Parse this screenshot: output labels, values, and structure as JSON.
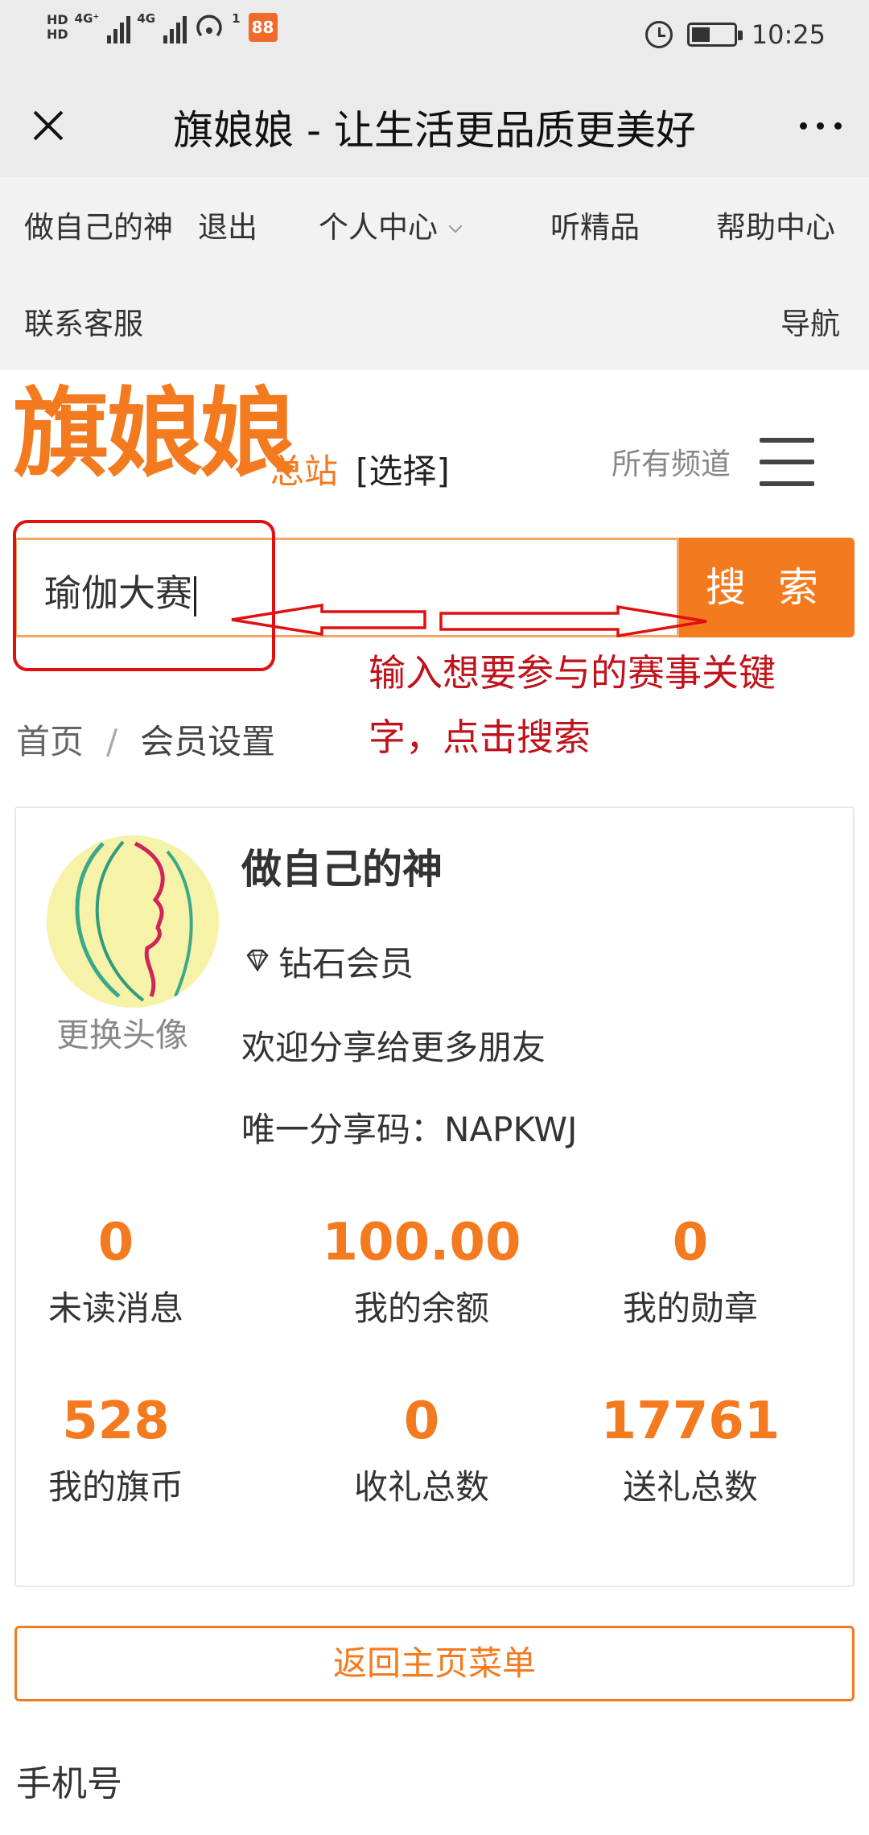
{
  "status_bar": {
    "hd1": "HD",
    "hd2": "HD",
    "net1": "4G⁺",
    "net2": "4G",
    "hotspot_sup": "1",
    "app_badge": "88",
    "time": "10:25"
  },
  "title_bar": {
    "title": "旗娘娘 - 让生活更品质更美好"
  },
  "top_nav": {
    "user": "做自己的神",
    "logout": "退出",
    "personal_center": "个人中心",
    "listen": "听精品",
    "help": "帮助中心",
    "contact": "联系客服",
    "navigate": "导航"
  },
  "header": {
    "logo": "旗娘娘",
    "station": "总站",
    "select": "[选择]",
    "channels": "所有频道"
  },
  "search": {
    "value": "瑜伽大赛",
    "button": "搜 索"
  },
  "annotation": {
    "line1": "输入想要参与的赛事关键",
    "line2": "字，点击搜索",
    "color": "#e01010"
  },
  "breadcrumb": {
    "home": "首页",
    "separator": "/",
    "current": "会员设置"
  },
  "profile": {
    "change_avatar": "更换头像",
    "username": "做自己的神",
    "member_level": "钻石会员",
    "welcome": "欢迎分享给更多朋友",
    "share_code": "唯一分享码：NAPKWJ",
    "stats": [
      {
        "value": "0",
        "label": "未读消息"
      },
      {
        "value": "100.00",
        "label": "我的余额"
      },
      {
        "value": "0",
        "label": "我的勋章"
      },
      {
        "value": "528",
        "label": "我的旗币"
      },
      {
        "value": "0",
        "label": "收礼总数"
      },
      {
        "value": "17761",
        "label": "送礼总数"
      }
    ]
  },
  "actions": {
    "back_home": "返回主页菜单"
  },
  "form": {
    "phone_label": "手机号"
  },
  "colors": {
    "accent": "#f47a1f",
    "annotation": "#e01010"
  }
}
